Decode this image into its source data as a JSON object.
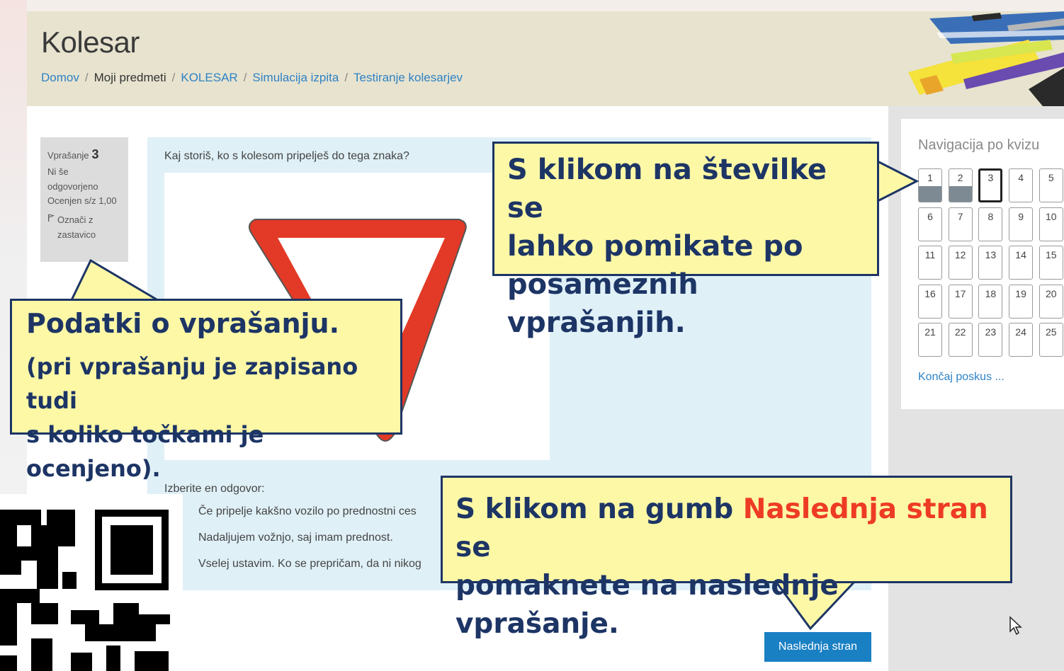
{
  "header": {
    "title": "Kolesar",
    "breadcrumb": [
      {
        "label": "Domov",
        "link": true
      },
      {
        "label": "Moji predmeti",
        "link": false
      },
      {
        "label": "KOLESAR",
        "link": true
      },
      {
        "label": "Simulacija izpita",
        "link": true
      },
      {
        "label": "Testiranje kolesarjev",
        "link": true
      }
    ]
  },
  "question_info": {
    "label": "Vprašanje",
    "number": "3",
    "status": "Ni še odgovorjeno",
    "grade": "Ocenjen s/z 1,00",
    "flag_label": "Označi z zastavico"
  },
  "question": {
    "text": "Kaj storiš, ko s kolesom pripelješ do tega znaka?",
    "answer_prompt": "Izberite en odgovor:",
    "options": [
      "Če pripelje kakšno vozilo po prednostni ces",
      "Nadaljujem vožnjo, saj imam prednost.",
      "Vselej ustavim. Ko se prepričam, da ni nikog"
    ],
    "next_button": "Naslednja stran"
  },
  "nav": {
    "title": "Navigacija po kvizu",
    "buttons": [
      "1",
      "2",
      "3",
      "4",
      "5",
      "6",
      "7",
      "8",
      "9",
      "10",
      "11",
      "12",
      "13",
      "14",
      "15",
      "16",
      "17",
      "18",
      "19",
      "20",
      "21",
      "22",
      "23",
      "24",
      "25"
    ],
    "answered": [
      "1",
      "2"
    ],
    "current": "3",
    "finish_link": "Končaj poskus ..."
  },
  "callouts": {
    "info_heading": "Podatki o vprašanju.",
    "info_body_1": "(pri vprašanju je zapisano tudi",
    "info_body_2": "s koliko točkami je ocenjeno).",
    "nav_line_1": "S klikom na številke se",
    "nav_line_2": "lahko pomikate po",
    "nav_line_3": "posameznih vprašanjih.",
    "next_pre": "S klikom na gumb ",
    "next_accent": "Naslednja stran",
    "next_post": " se",
    "next_line_2": "pomaknete na naslednje vprašanje."
  },
  "colors": {
    "link": "#2f82c5",
    "button": "#1a80c4",
    "callout_fill": "#fdf8a6",
    "callout_border": "#1d3565",
    "accent_red": "#ee3b24",
    "sign_red": "#e23a26"
  }
}
